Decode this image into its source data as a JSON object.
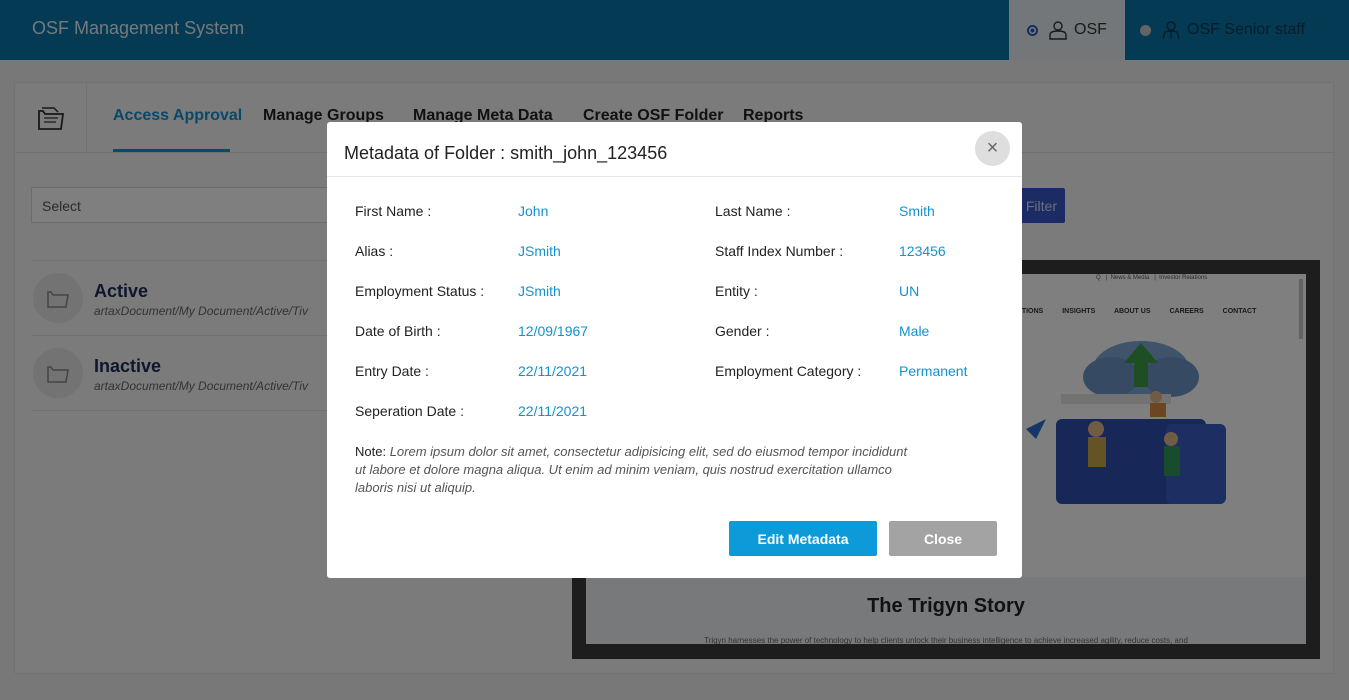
{
  "header": {
    "app_title": "OSF Management System",
    "roles": [
      {
        "label": "OSF",
        "selected": true
      },
      {
        "label": "OSF Senior staff",
        "selected": false
      }
    ]
  },
  "tabs": [
    {
      "label": "Access Approval",
      "active": true
    },
    {
      "label": "Manage Groups"
    },
    {
      "label": "Manage Meta Data"
    },
    {
      "label": "Create OSF Folder"
    },
    {
      "label": "Reports"
    }
  ],
  "filters": {
    "select_value": "Select",
    "filter_button": "Filter"
  },
  "folders": [
    {
      "name": "Active",
      "path": "artaxDocument/My Document/Active/Tiv"
    },
    {
      "name": "Inactive",
      "path": "artaxDocument/My Document/Active/Tiv"
    }
  ],
  "preview": {
    "top_links": [
      "Q",
      "News & Media",
      "Investor Relations"
    ],
    "nav": [
      "...TIONS",
      "INSIGHTS",
      "ABOUT US",
      "CAREERS",
      "CONTACT"
    ],
    "story_title": "The Trigyn Story",
    "story_sub": "Trigyn harnesses the power of technology to help clients unlock their business intelligence to achieve increased agility, reduce costs, and"
  },
  "modal": {
    "title": "Metadata of Folder : smith_john_123456",
    "close_icon": "×",
    "fields_left": [
      {
        "label": "First Name :",
        "value": "John"
      },
      {
        "label": "Alias :",
        "value": "JSmith"
      },
      {
        "label": "Employment Status :",
        "value": "JSmith"
      },
      {
        "label": "Date of Birth :",
        "value": "12/09/1967"
      },
      {
        "label": "Entry Date :",
        "value": "22/11/2021"
      },
      {
        "label": "Seperation Date :",
        "value": "22/11/2021"
      }
    ],
    "fields_right": [
      {
        "label": "Last Name :",
        "value": "Smith"
      },
      {
        "label": "Staff Index Number :",
        "value": "123456"
      },
      {
        "label": "Entity :",
        "value": "UN"
      },
      {
        "label": "Gender :",
        "value": "Male"
      },
      {
        "label": "Employment Category :",
        "value": "Permanent"
      }
    ],
    "note_label": "Note:",
    "note_text": "Lorem ipsum dolor sit amet, consectetur adipisicing elit, sed do eiusmod tempor incididunt ut labore et dolore magna aliqua. Ut enim ad minim veniam, quis nostrud exercitation ullamco laboris nisi ut aliquip.",
    "edit_button": "Edit Metadata",
    "close_button": "Close"
  },
  "colors": {
    "header_bg": "#0a75a8",
    "accent": "#1293d1",
    "edit_button": "#0d9ad8",
    "close_button": "#a3a3a3"
  }
}
